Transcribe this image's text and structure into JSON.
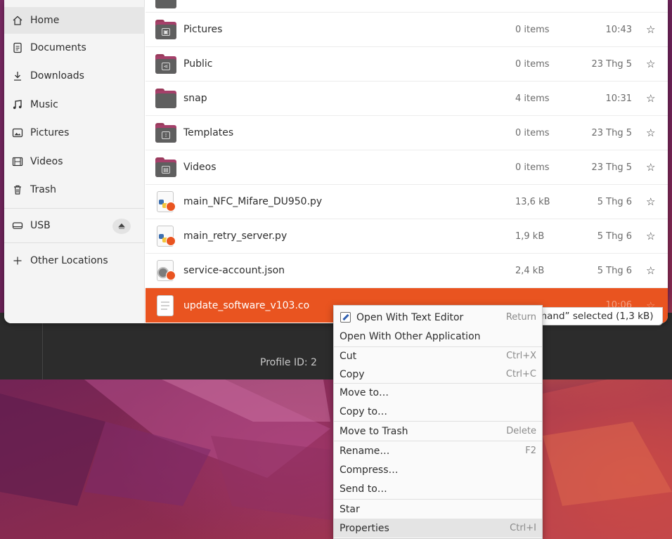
{
  "sidebar": {
    "items": [
      {
        "label": "Home",
        "icon": "home-icon"
      },
      {
        "label": "Documents",
        "icon": "document-icon"
      },
      {
        "label": "Downloads",
        "icon": "download-icon"
      },
      {
        "label": "Music",
        "icon": "music-icon"
      },
      {
        "label": "Pictures",
        "icon": "picture-icon"
      },
      {
        "label": "Videos",
        "icon": "video-icon"
      },
      {
        "label": "Trash",
        "icon": "trash-icon"
      }
    ],
    "usb": {
      "label": "USB",
      "icon": "drive-icon"
    },
    "other_locations": {
      "label": "Other Locations",
      "icon": "plus-icon"
    }
  },
  "files": [
    {
      "name": "Pictures",
      "size": "0 items",
      "date": "10:43",
      "kind": "folder-pictures"
    },
    {
      "name": "Public",
      "size": "0 items",
      "date": "23 Thg 5",
      "kind": "folder-public"
    },
    {
      "name": "snap",
      "size": "4 items",
      "date": "10:31",
      "kind": "folder"
    },
    {
      "name": "Templates",
      "size": "0 items",
      "date": "23 Thg 5",
      "kind": "folder-templates"
    },
    {
      "name": "Videos",
      "size": "0 items",
      "date": "23 Thg 5",
      "kind": "folder-videos"
    },
    {
      "name": "main_NFC_Mifare_DU950.py",
      "size": "13,6 kB",
      "date": "5 Thg 6",
      "kind": "python-locked"
    },
    {
      "name": "main_retry_server.py",
      "size": "1,9 kB",
      "date": "5 Thg 6",
      "kind": "python-locked"
    },
    {
      "name": "service-account.json",
      "size": "2,4 kB",
      "date": "5 Thg 6",
      "kind": "json-locked"
    }
  ],
  "selected_file": {
    "name": "update_software_v103.co",
    "date": "10:06"
  },
  "star_glyph": "☆",
  "status_text": "mand” selected  (1,3 kB)",
  "background_app": {
    "profile_text": "Profile ID: 2"
  },
  "context_menu": {
    "items": [
      {
        "label": "Open With Text Editor",
        "accel": "Return"
      },
      {
        "label": "Open With Other Application",
        "accel": ""
      },
      {
        "label": "Cut",
        "accel": "Ctrl+X"
      },
      {
        "label": "Copy",
        "accel": "Ctrl+C"
      },
      {
        "label": "Move to…",
        "accel": ""
      },
      {
        "label": "Copy to…",
        "accel": ""
      },
      {
        "label": "Move to Trash",
        "accel": "Delete"
      },
      {
        "label": "Rename…",
        "accel": "F2"
      },
      {
        "label": "Compress…",
        "accel": ""
      },
      {
        "label": "Send to…",
        "accel": ""
      },
      {
        "label": "Star",
        "accel": ""
      },
      {
        "label": "Properties",
        "accel": "Ctrl+I"
      }
    ]
  },
  "colors": {
    "accent": "#e95420",
    "folder": "#a5406a"
  }
}
